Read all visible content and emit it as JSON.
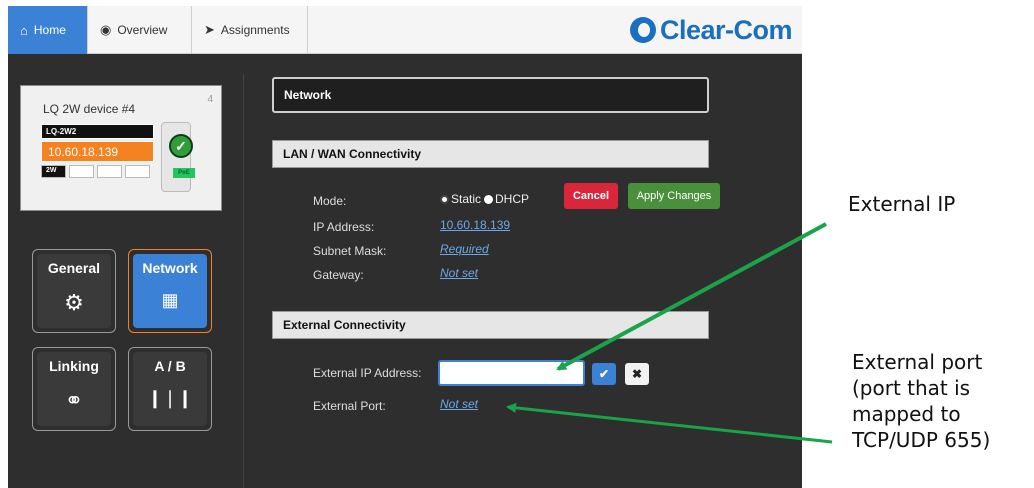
{
  "tabs": [
    {
      "label": "Home",
      "icon": "home-icon",
      "active": true
    },
    {
      "label": "Overview",
      "icon": "globe-icon",
      "active": false
    },
    {
      "label": "Assignments",
      "icon": "assignments-icon",
      "active": false
    }
  ],
  "brand": {
    "logo_text": "Clear-Com",
    "color": "#1b6fbf"
  },
  "device": {
    "name": "LQ 2W device #4",
    "number": "4",
    "model": "LQ-2W2",
    "ip": "10.60.18.139",
    "port_label": "2W",
    "poe_label": "PoE"
  },
  "tiles": [
    {
      "label": "General",
      "icon": "gear-icon",
      "active": false
    },
    {
      "label": "Network",
      "icon": "network-icon",
      "active": true
    },
    {
      "label": "Linking",
      "icon": "link-icon",
      "active": false
    },
    {
      "label": "A / B",
      "icon": "audio-icon",
      "active": false
    }
  ],
  "panel": {
    "title": "Network"
  },
  "lan": {
    "header": "LAN / WAN Connectivity",
    "mode_label": "Mode:",
    "mode_options": [
      "Static",
      "DHCP"
    ],
    "mode_selected": "Static",
    "ip_label": "IP Address:",
    "ip_value": "10.60.18.139",
    "subnet_label": "Subnet Mask:",
    "subnet_value": "Required",
    "gateway_label": "Gateway:",
    "gateway_value": "Not set",
    "cancel_label": "Cancel",
    "apply_label": "Apply Changes"
  },
  "external": {
    "header": "External Connectivity",
    "ip_label": "External IP Address:",
    "ip_value": "",
    "port_label": "External Port:",
    "port_value": "Not set"
  },
  "annotations": {
    "external_ip": "External IP",
    "external_port_lines": [
      "External port",
      "(port that is",
      "mapped to",
      "TCP/UDP 655)"
    ],
    "arrow_color": "#1aa34a"
  },
  "colors": {
    "accent": "#3b82d6",
    "highlight": "#f58220",
    "cancel": "#d9263b",
    "apply": "#4a8f3c"
  }
}
